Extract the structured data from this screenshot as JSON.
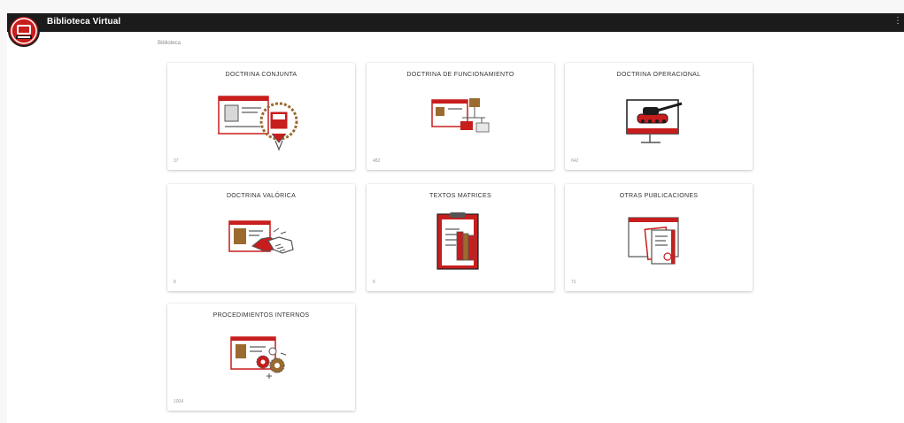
{
  "app": {
    "title": "Biblioteca Virtual",
    "menu_glyph": "⋮"
  },
  "breadcrumb": "Biblioteca",
  "colors": {
    "accent": "#c81d1d",
    "topbar": "#1b1b1b",
    "gold": "#9b6a2f"
  },
  "cards": [
    {
      "title": "DOCTRINA CONJUNTA",
      "count": "37",
      "icon": "emblem-document-icon"
    },
    {
      "title": "DOCTRINA DE FUNCIONAMIENTO",
      "count": "482",
      "icon": "flowchart-icon"
    },
    {
      "title": "DOCTRINA OPERACIONAL",
      "count": "642",
      "icon": "tank-monitor-icon"
    },
    {
      "title": "DOCTRINA VALÓRICA",
      "count": "8",
      "icon": "handshake-icon"
    },
    {
      "title": "TEXTOS MATRICES",
      "count": "6",
      "icon": "clipboard-books-icon"
    },
    {
      "title": "OTRAS PUBLICACIONES",
      "count": "71",
      "icon": "publications-icon"
    },
    {
      "title": "PROCEDIMIENTOS INTERNOS",
      "count": "1004",
      "icon": "gears-document-icon"
    }
  ]
}
